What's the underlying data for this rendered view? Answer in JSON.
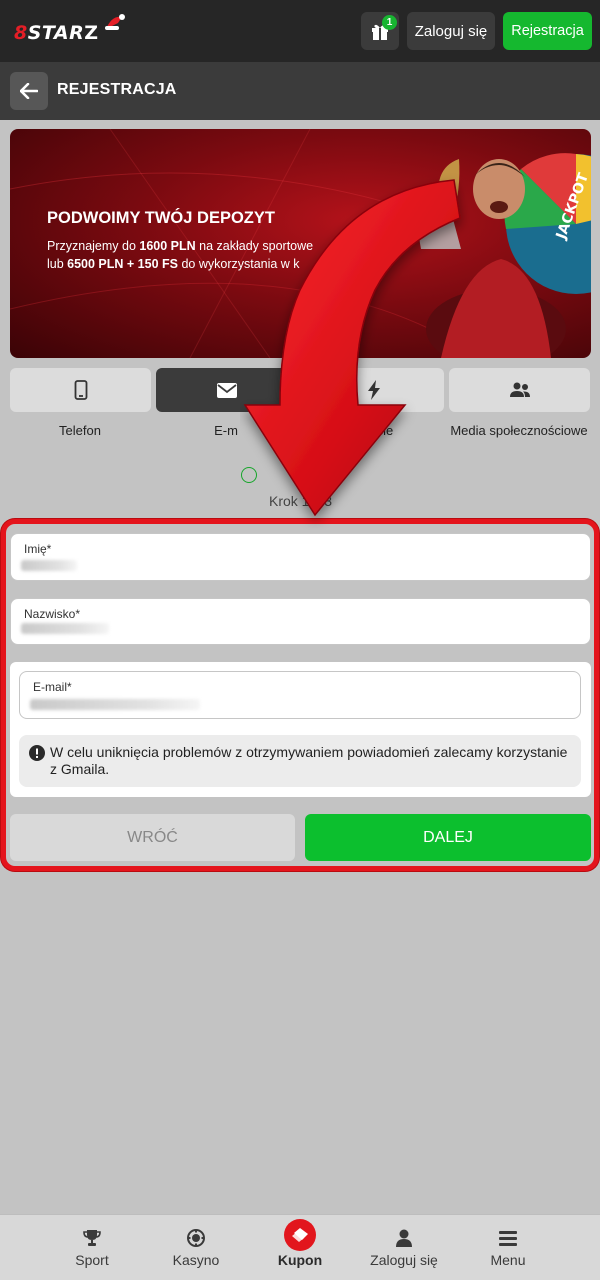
{
  "header": {
    "logo": "8STAR",
    "gift_badge": "1",
    "login_label": "Zaloguj się",
    "register_label": "Rejestracja"
  },
  "subheader": {
    "title": "REJESTRACJA"
  },
  "banner": {
    "title": "PODWOIMY TWÓJ DEPOZYT",
    "line1_pre": "Przyznajemy do ",
    "line1_bold": "1600 PLN",
    "line1_post": " na zakłady sportowe",
    "line2_pre": "lub ",
    "line2_bold": "6500 PLN + 150 FS",
    "line2_post": " do wykorzystania w k"
  },
  "methods": [
    {
      "label": "Telefon",
      "icon": "phone-icon"
    },
    {
      "label": "E-m",
      "icon": "envelope-icon",
      "active": true
    },
    {
      "label": "knięcie",
      "icon": "lightning-icon"
    },
    {
      "label": "Media społecznościowe",
      "icon": "users-icon"
    }
  ],
  "step": {
    "text": "Krok 1 z 3"
  },
  "form": {
    "first_name_label": "Imię*",
    "last_name_label": "Nazwisko*",
    "email_label": "E-mail*",
    "info": "W celu uniknięcia problemów z otrzymywaniem powiadomień zalecamy korzystanie z Gmaila.",
    "back_label": "WRÓĆ",
    "next_label": "DALEJ"
  },
  "colors": {
    "brand_red": "#e41e26",
    "accent_green": "#0cbf2e",
    "header_bg": "#262626"
  },
  "bottom_nav": [
    {
      "label": "Sport",
      "icon": "trophy-icon"
    },
    {
      "label": "Kasyno",
      "icon": "casino-chip-icon"
    },
    {
      "label": "Kupon",
      "icon": "ticket-icon"
    },
    {
      "label": "Zaloguj się",
      "icon": "user-icon"
    },
    {
      "label": "Menu",
      "icon": "hamburger-icon"
    }
  ]
}
